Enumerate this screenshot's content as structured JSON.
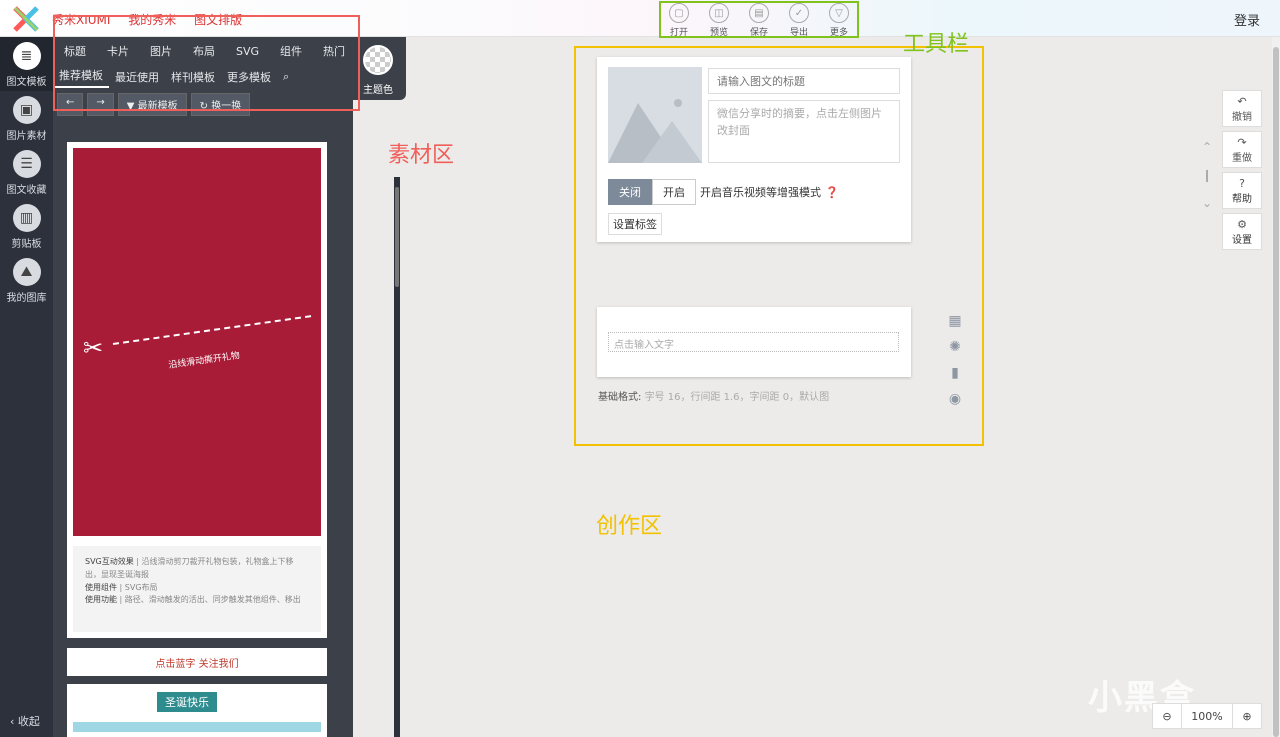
{
  "header": {
    "breadcrumb": [
      "秀米XIUMI",
      "我的秀米",
      "图文排版"
    ],
    "login": "登录"
  },
  "toolbar": {
    "items": [
      {
        "label": "打开",
        "icon": "folder-icon"
      },
      {
        "label": "预览",
        "icon": "preview-icon"
      },
      {
        "label": "保存",
        "icon": "save-icon"
      },
      {
        "label": "导出",
        "icon": "check-icon"
      },
      {
        "label": "更多",
        "icon": "more-icon"
      }
    ]
  },
  "leftnav": {
    "items": [
      {
        "label": "图文模板",
        "active": true
      },
      {
        "label": "图片素材"
      },
      {
        "label": "图文收藏"
      },
      {
        "label": "剪贴板"
      },
      {
        "label": "我的图库"
      }
    ],
    "collapse": "收起"
  },
  "material": {
    "tabs_row1": [
      "标题",
      "卡片",
      "图片",
      "布局",
      "SVG",
      "组件",
      "热门"
    ],
    "tabs_row2": [
      "推荐模板",
      "最近使用",
      "样刊模板",
      "更多模板"
    ],
    "btn_latest": "最新模板",
    "btn_shuffle": "换一换",
    "theme_label": "主题色",
    "card1": {
      "poster_text": "沿线滑动撕开礼物",
      "desc_line1_label": "SVG互动效果",
      "desc_line1": "沿线滑动剪刀裁开礼物包装，礼物盒上下移出，显现圣诞海报",
      "desc_line2_label": "使用组件",
      "desc_line2": "SVG布局",
      "desc_line3_label": "使用功能",
      "desc_line3": "路径、滑动触发的活出、同步触发其他组件、移出"
    },
    "card2_text": "点击蓝字 关注我们",
    "card3_text": "圣诞快乐"
  },
  "editor": {
    "title_placeholder": "请输入图文的标题",
    "abstract_placeholder": "微信分享时的摘要，点击左侧图片改封面",
    "toggle_off": "关闭",
    "toggle_on": "开启",
    "toggle_label": "开启音乐视频等增强模式",
    "tag_btn": "设置标签",
    "text_placeholder": "点击输入文字",
    "format_label": "基础格式:",
    "format_value": "字号 16，行间距 1.6，字间距 0，默认图"
  },
  "annotations": {
    "toolbar": "工具栏",
    "material": "素材区",
    "create": "创作区"
  },
  "rpanel": {
    "undo": "撤销",
    "redo": "重做",
    "help": "帮助",
    "settings": "设置"
  },
  "zoom": {
    "value": "100%"
  },
  "watermark": "小黑盒"
}
